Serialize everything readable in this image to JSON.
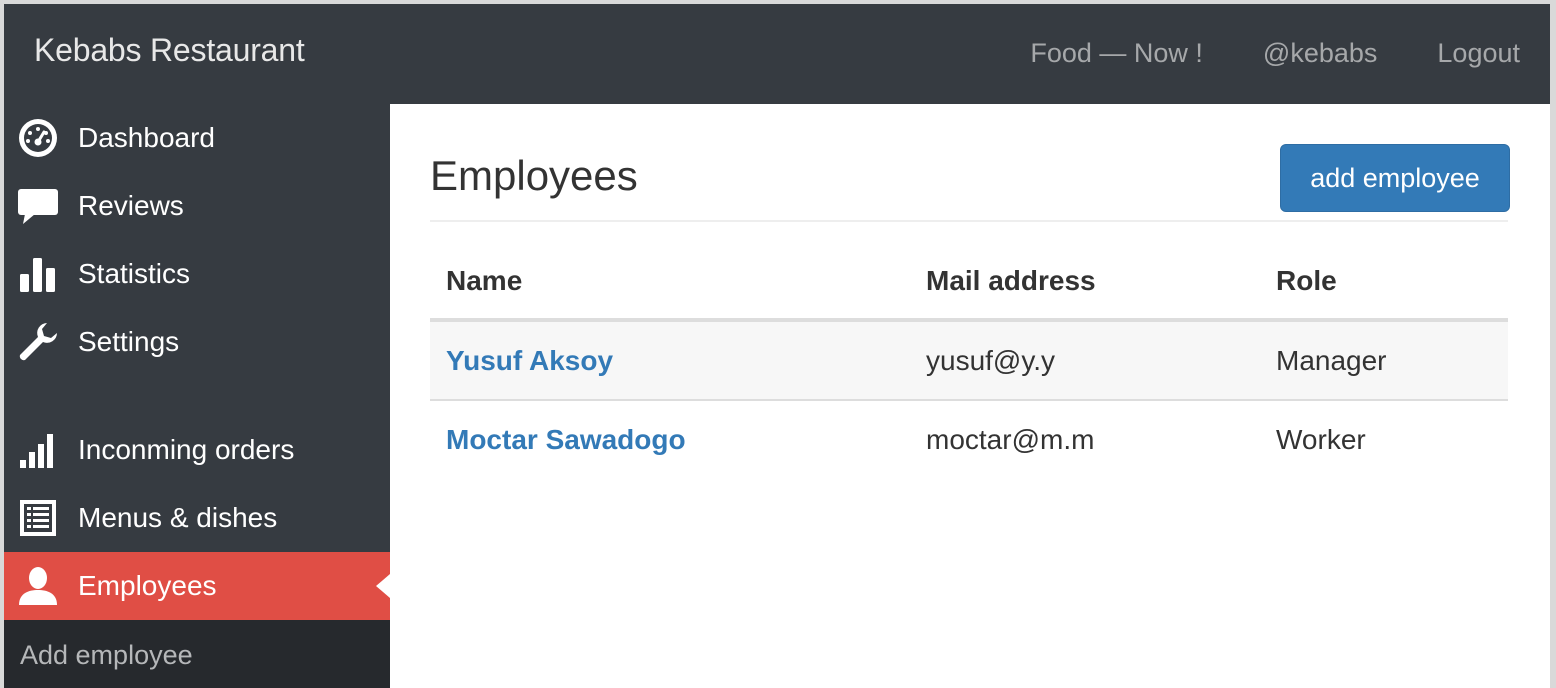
{
  "app": {
    "brand": "Kebabs Restaurant"
  },
  "topnav": {
    "items": [
      {
        "label": "Food — Now !"
      },
      {
        "label": "@kebabs"
      },
      {
        "label": "Logout"
      }
    ]
  },
  "sidebar": {
    "items": [
      {
        "label": "Dashboard",
        "icon": "dashboard-icon"
      },
      {
        "label": "Reviews",
        "icon": "comment-icon"
      },
      {
        "label": "Statistics",
        "icon": "bar-chart-icon"
      },
      {
        "label": "Settings",
        "icon": "wrench-icon"
      },
      {
        "label": "Inconming orders",
        "icon": "signal-icon"
      },
      {
        "label": "Menus & dishes",
        "icon": "list-icon"
      },
      {
        "label": "Employees",
        "icon": "user-icon",
        "active": true
      }
    ],
    "subnav": {
      "label": "Add employee"
    }
  },
  "main": {
    "title": "Employees",
    "add_button": "add employee",
    "table": {
      "headers": [
        "Name",
        "Mail address",
        "Role"
      ],
      "rows": [
        {
          "name": "Yusuf Aksoy",
          "mail": "yusuf@y.y",
          "role": "Manager"
        },
        {
          "name": "Moctar Sawadogo",
          "mail": "moctar@m.m",
          "role": "Worker"
        }
      ]
    }
  },
  "colors": {
    "navbar": "#363b41",
    "active": "#e04e45",
    "primary": "#337ab7"
  }
}
